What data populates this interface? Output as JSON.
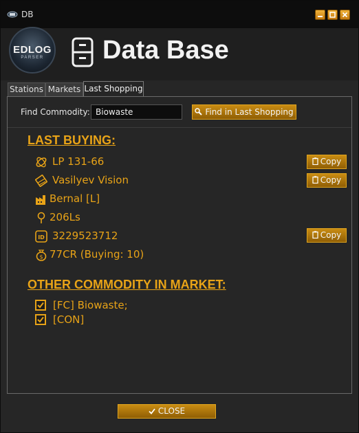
{
  "window": {
    "title": "DB"
  },
  "header": {
    "logo_text": "EDLOG",
    "logo_subtext": "PARSER",
    "title": "Data Base"
  },
  "tabs": [
    {
      "label": "Stations",
      "active": false
    },
    {
      "label": "Markets",
      "active": false
    },
    {
      "label": "Last Shopping",
      "active": true
    }
  ],
  "find": {
    "label": "Find Commodity:",
    "value": "Biowaste",
    "button_label": "Find in Last Shopping"
  },
  "last_buying": {
    "heading": "LAST BUYING:",
    "station": "LP 131-66",
    "system": "Vasilyev Vision",
    "body": "Bernal [L]",
    "distance": "206Ls",
    "market_id": "3229523712",
    "price": "77CR (Buying: 10)",
    "copy_label": "Copy"
  },
  "other_commodity": {
    "heading": "OTHER COMMODITY IN MARKET:",
    "items": [
      {
        "label": "[FC] Biowaste;",
        "checked": true
      },
      {
        "label": "[CON]",
        "checked": true
      }
    ]
  },
  "footer": {
    "close_label": "CLOSE"
  },
  "colors": {
    "accent": "#e8a317",
    "button_gold": "#c98c12",
    "background": "#262626",
    "titlebar": "#0d0d0d"
  }
}
